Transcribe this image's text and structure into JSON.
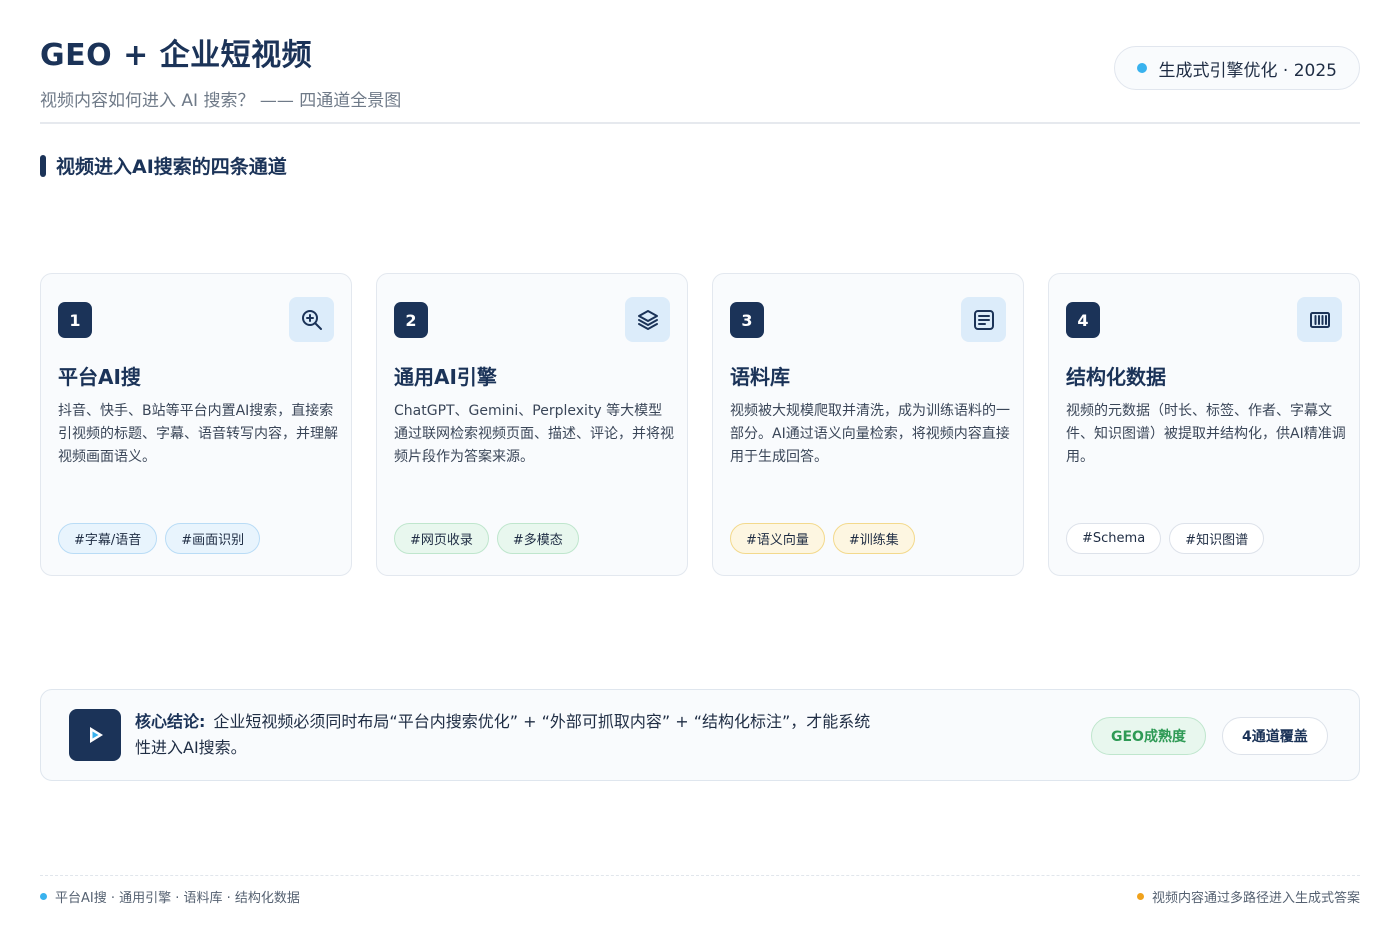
{
  "header": {
    "title": "GEO + 企业短视频",
    "subtitle": "视频内容如何进入 AI 搜索？ —— 四通道全景图",
    "badge": "生成式引擎优化 · 2025"
  },
  "section": {
    "title": "视频进入AI搜索的四条通道"
  },
  "cards": [
    {
      "number": "1",
      "icon": "search-zoom-icon",
      "title": "平台AI搜",
      "desc": "抖音、快手、B站等平台内置AI搜索，直接索引视频的标题、字幕、语音转写内容，并理解视频画面语义。",
      "tags": [
        "#字幕/语音",
        "#画面识别"
      ],
      "tag_color": "#e8f4fd"
    },
    {
      "number": "2",
      "icon": "layers-icon",
      "title": "通用AI引擎",
      "desc": "ChatGPT、Gemini、Perplexity 等大模型通过联网检索视频页面、描述、评论，并将视频片段作为答案来源。",
      "tags": [
        "#网页收录",
        "#多模态"
      ],
      "tag_color": "#e8f7ee"
    },
    {
      "number": "3",
      "icon": "document-icon",
      "title": "语料库",
      "desc": "视频被大规模爬取并清洗，成为训练语料的一部分。AI通过语义向量检索，将视频内容直接用于生成回答。",
      "tags": [
        "#语义向量",
        "#训练集"
      ],
      "tag_color": "#fdf6e1"
    },
    {
      "number": "4",
      "icon": "barcode-icon",
      "title": "结构化数据",
      "desc": "视频的元数据（时长、标签、作者、字幕文件、知识图谱）被提取并结构化，供AI精准调用。",
      "tags": [
        "#Schema",
        "#知识图谱"
      ],
      "tag_color": "#ffffff"
    }
  ],
  "conclusion": {
    "label": "核心结论:",
    "text": "企业短视频必须同时布局“平台内搜索优化” + “外部可抓取内容” + “结构化标注”，才能系统性进入AI搜索。",
    "pill_1": "GEO成熟度",
    "pill_2": "4通道覆盖"
  },
  "footer": {
    "left": "平台AI搜 · 通用引擎 · 语料库 · 结构化数据",
    "right": "视频内容通过多路径进入生成式答案"
  },
  "colors": {
    "primary": "#1b3358",
    "accent_blue": "#39b2ee",
    "accent_orange": "#f0a21c",
    "accent_green": "#2e9a55"
  }
}
